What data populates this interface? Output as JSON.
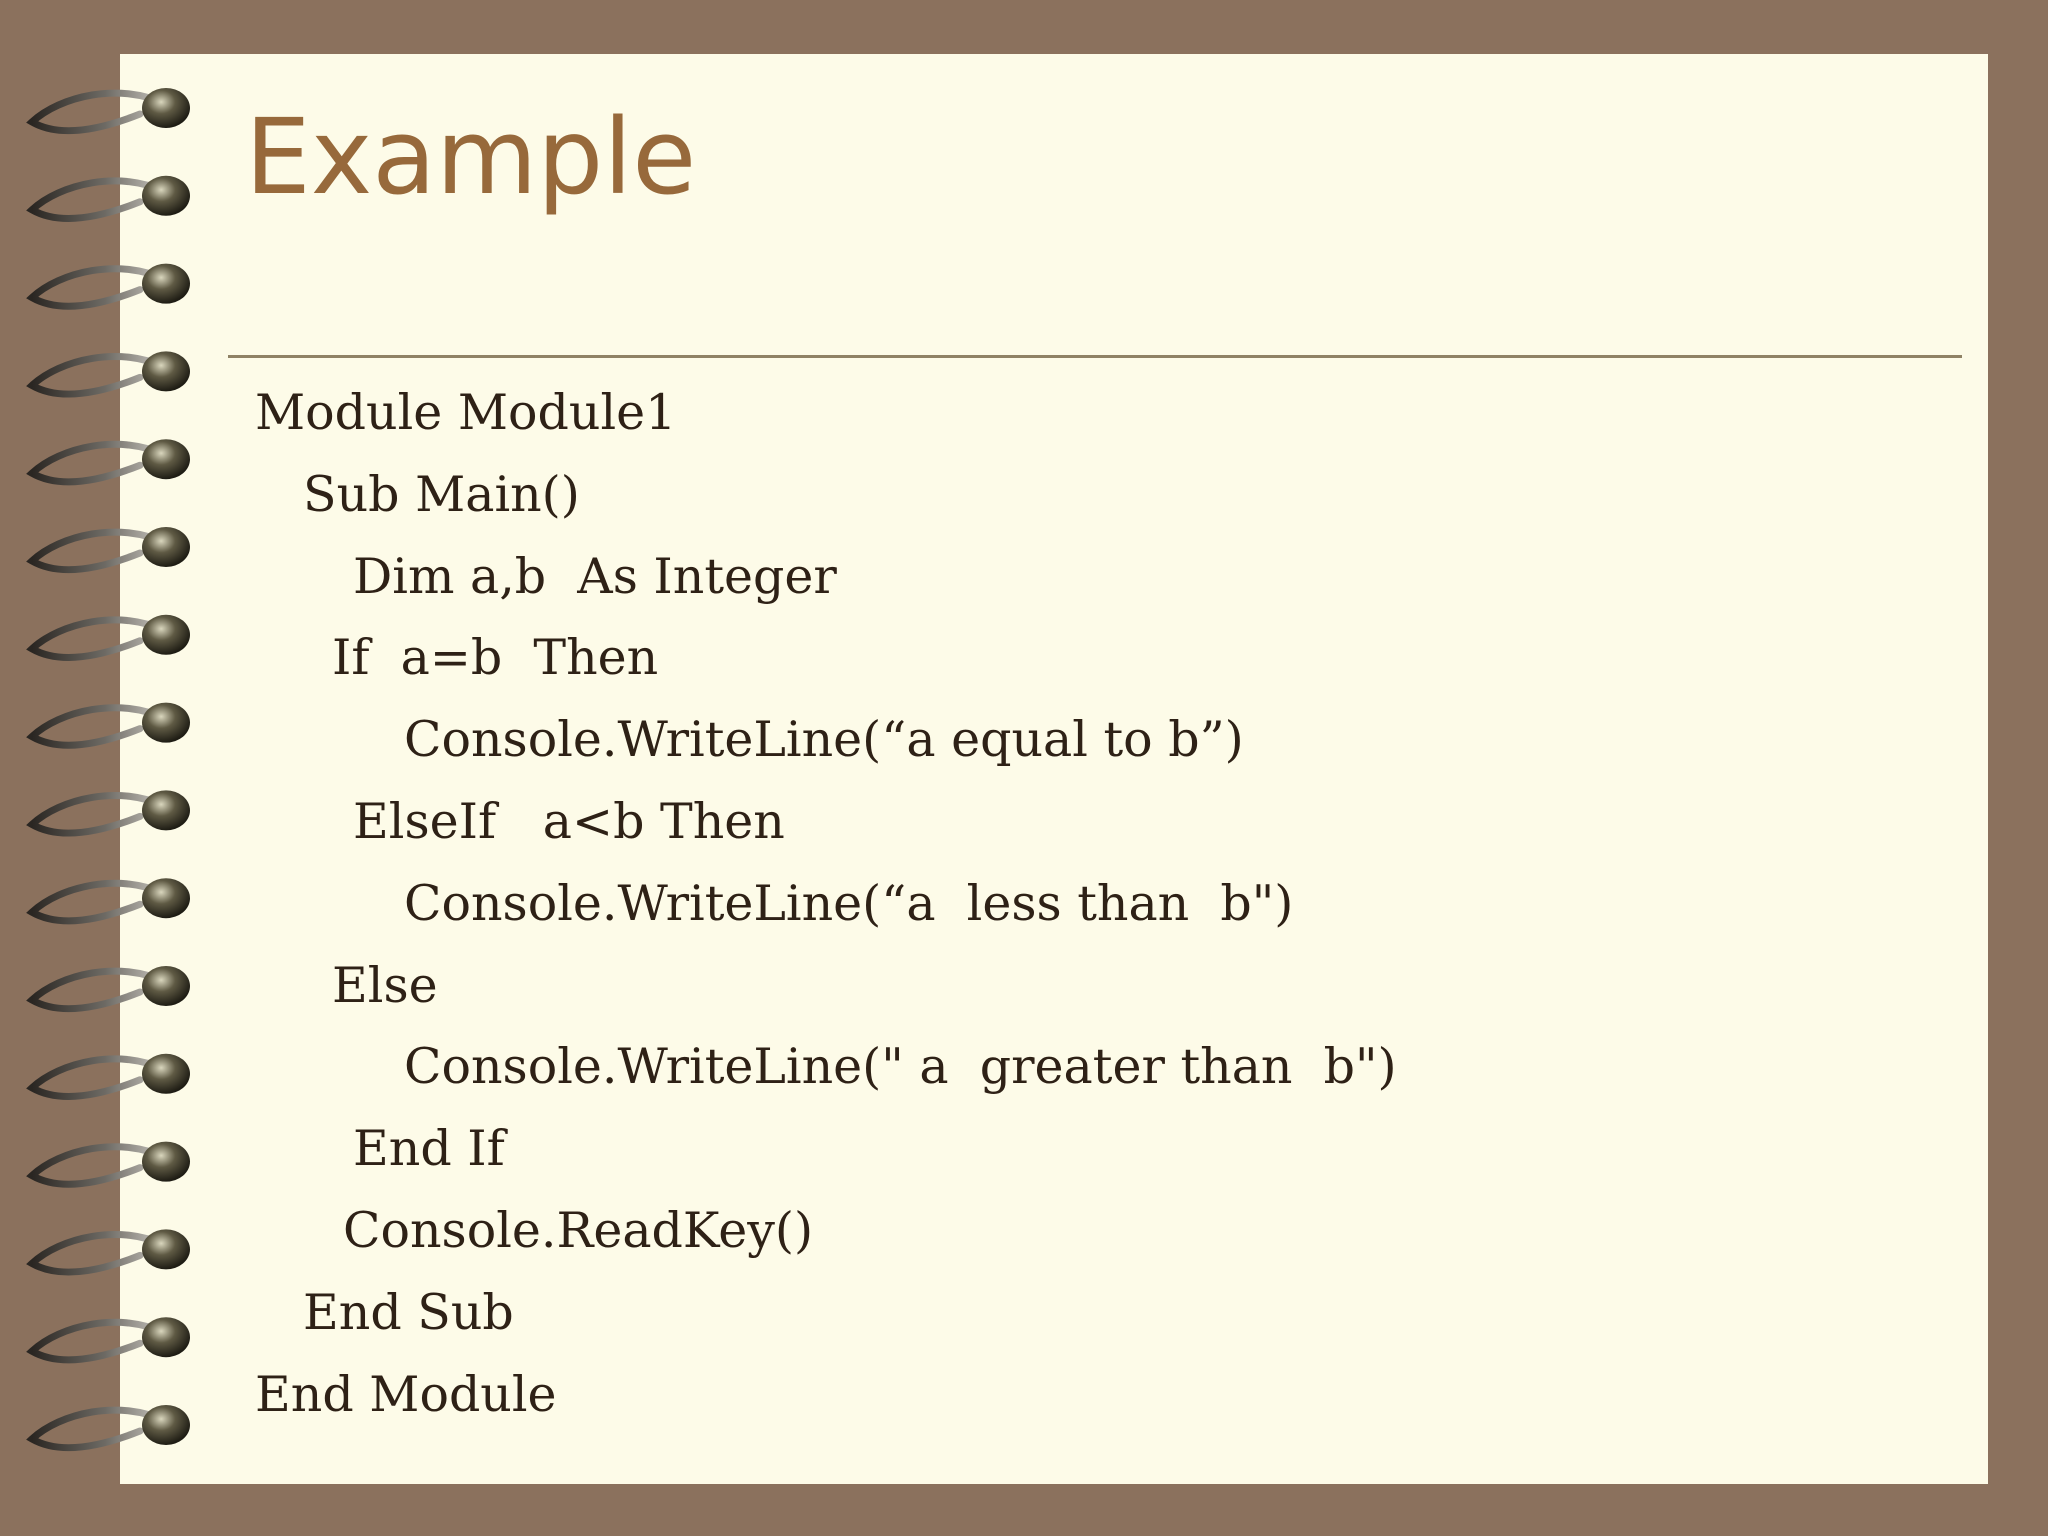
{
  "slide": {
    "title": "Example",
    "code_lines": [
      {
        "indent": 0,
        "text": "Module Module1"
      },
      {
        "indent": 48,
        "text": "Sub Main()"
      },
      {
        "indent": 98,
        "text": "Dim a,b  As Integer"
      },
      {
        "indent": 77,
        "text": "If  a=b  Then"
      },
      {
        "indent": 149,
        "text": "Console.WriteLine(“a equal to b”)"
      },
      {
        "indent": 98,
        "text": "ElseIf   a<b Then"
      },
      {
        "indent": 149,
        "text": "Console.WriteLine(“a  less than  b\")"
      },
      {
        "indent": 77,
        "text": "Else"
      },
      {
        "indent": 149,
        "text": "Console.WriteLine(\" a  greater than  b\")"
      },
      {
        "indent": 98,
        "text": "End If"
      },
      {
        "indent": 88,
        "text": "Console.ReadKey()"
      },
      {
        "indent": 48,
        "text": "End Sub"
      },
      {
        "indent": 0,
        "text": "End Module"
      }
    ]
  },
  "colors": {
    "frame": "#8b715d",
    "paper": "#fdfbe8",
    "title": "#97693b",
    "text": "#2e2116",
    "rule": "#8f8265"
  },
  "decor": {
    "binding": "spiral-binding-icon",
    "ring_count": 16
  }
}
